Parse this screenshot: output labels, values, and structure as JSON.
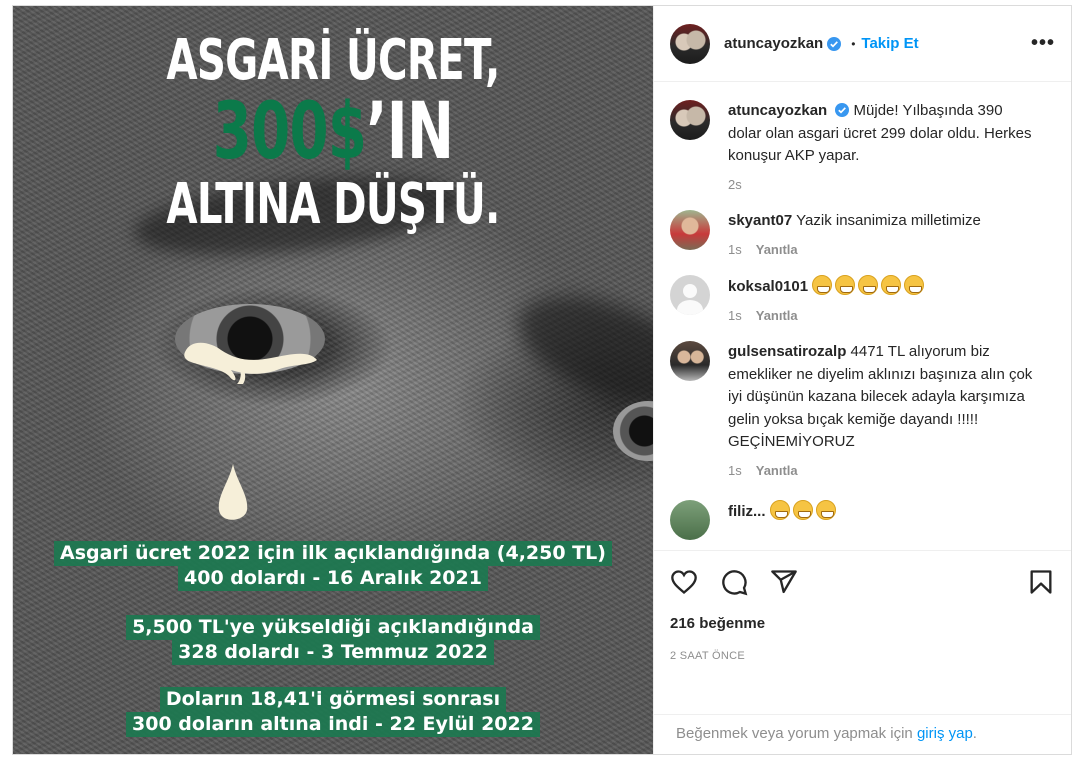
{
  "post_image": {
    "headline_line1": "ASGARİ ÜCRET,",
    "headline_line2_green": "300$",
    "headline_line2_white": "’IN",
    "headline_line3": "ALTINA DÜŞTÜ.",
    "info": [
      {
        "line1": "Asgari ücret 2022 için ilk açıklandığında (4,250 TL)",
        "line2": "400 dolardı - 16 Aralık 2021"
      },
      {
        "line1": "5,500 TL'ye yükseldiği açıklandığında",
        "line2": "328 dolardı - 3 Temmuz 2022"
      },
      {
        "line1": "Doların 18,41'i görmesi sonrası",
        "line2": "300 doların altına indi - 22 Eylül 2022"
      }
    ]
  },
  "header": {
    "username": "atuncayozkan",
    "separator": "•",
    "follow_label": "Takip Et",
    "more_label": "•••"
  },
  "caption": {
    "username": "atuncayozkan",
    "text": "Müjde! Yılbaşında 390 dolar olan asgari ücret 299 dolar oldu. Herkes konuşur AKP yapar.",
    "time": "2s"
  },
  "comments": [
    {
      "username": "skyant07",
      "text": "Yazik insanimiza milletimize",
      "time": "1s",
      "reply_label": "Yanıtla"
    },
    {
      "username": "koksal0101",
      "text": "",
      "emoji_count": 5,
      "time": "1s",
      "reply_label": "Yanıtla"
    },
    {
      "username": "gulsensatirozalp",
      "text": "4471 TL alıyorum biz emekliker ne diyelim aklınızı başınıza alın çok iyi düşünün kazana bilecek adayla karşımıza gelin yoksa bıçak kemiğe dayandı !!!!! GEÇİNEMİYORUZ",
      "time": "1s",
      "reply_label": "Yanıtla"
    },
    {
      "username": "filiz...",
      "text": "",
      "emoji_count": 3
    }
  ],
  "icons": {
    "like": "heart-icon",
    "comment": "comment-icon",
    "share": "share-icon",
    "save": "bookmark-icon"
  },
  "likes_text": "216 beğenme",
  "time_ago": "2 SAAT ÖNCE",
  "login_prompt": {
    "prefix": "Beğenmek veya yorum yapmak için ",
    "link": "giriş yap",
    "suffix": "."
  },
  "colors": {
    "accent_blue": "#0095f6",
    "headline_green": "#0b7a4a",
    "info_highlight": "#1c7850"
  }
}
